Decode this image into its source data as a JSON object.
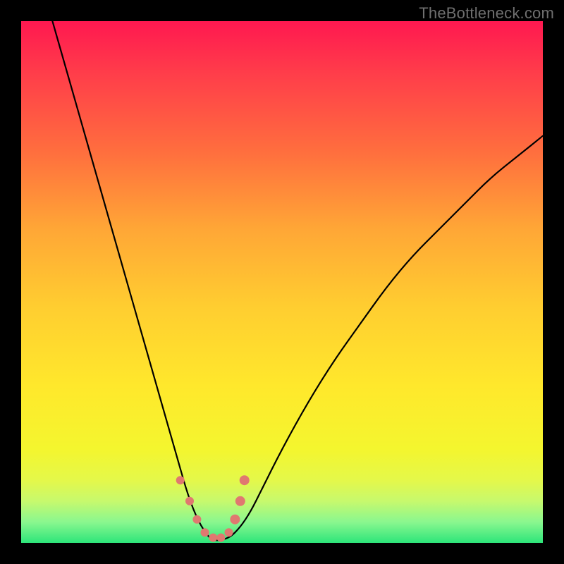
{
  "watermark": "TheBottleneck.com",
  "colors": {
    "frame": "#000000",
    "curve": "#000000",
    "markerFill": "#e07870",
    "markerStroke": "#e07870"
  },
  "chart_data": {
    "type": "line",
    "title": "",
    "xlabel": "",
    "ylabel": "",
    "xlim": [
      0,
      100
    ],
    "ylim": [
      0,
      100
    ],
    "grid": false,
    "series": [
      {
        "name": "bottleneck-curve",
        "x": [
          6,
          8,
          10,
          12,
          14,
          16,
          18,
          20,
          22,
          24,
          26,
          28,
          30,
          32,
          34,
          36,
          37,
          38,
          40,
          42,
          44,
          46,
          50,
          55,
          60,
          65,
          70,
          75,
          80,
          85,
          90,
          95,
          100
        ],
        "y": [
          100,
          93,
          86,
          79,
          72,
          65,
          58,
          51,
          44,
          37,
          30,
          23,
          16,
          9,
          4,
          1,
          0.5,
          0.5,
          1,
          3,
          6,
          10,
          18,
          27,
          35,
          42,
          49,
          55,
          60,
          65,
          70,
          74,
          78
        ]
      }
    ],
    "markers": {
      "name": "valley-points",
      "x": [
        30.5,
        32.3,
        33.7,
        35.2,
        36.8,
        38.3,
        39.8,
        41.0,
        42.0,
        42.8
      ],
      "y": [
        12,
        8,
        4.5,
        2,
        1,
        1,
        2,
        4.5,
        8,
        12
      ],
      "r": [
        5.5,
        5.5,
        5.5,
        5.5,
        5.5,
        5.5,
        5.5,
        6.5,
        6.5,
        6.5
      ]
    },
    "background_gradient": [
      {
        "stop": 0.0,
        "color": "#ff1850"
      },
      {
        "stop": 0.1,
        "color": "#ff3d4a"
      },
      {
        "stop": 0.25,
        "color": "#ff6e3e"
      },
      {
        "stop": 0.4,
        "color": "#ffa736"
      },
      {
        "stop": 0.55,
        "color": "#ffce30"
      },
      {
        "stop": 0.7,
        "color": "#ffe82c"
      },
      {
        "stop": 0.82,
        "color": "#f4f62e"
      },
      {
        "stop": 0.88,
        "color": "#e4f84a"
      },
      {
        "stop": 0.92,
        "color": "#c7f96d"
      },
      {
        "stop": 0.96,
        "color": "#8af78f"
      },
      {
        "stop": 1.0,
        "color": "#2de57a"
      }
    ]
  }
}
